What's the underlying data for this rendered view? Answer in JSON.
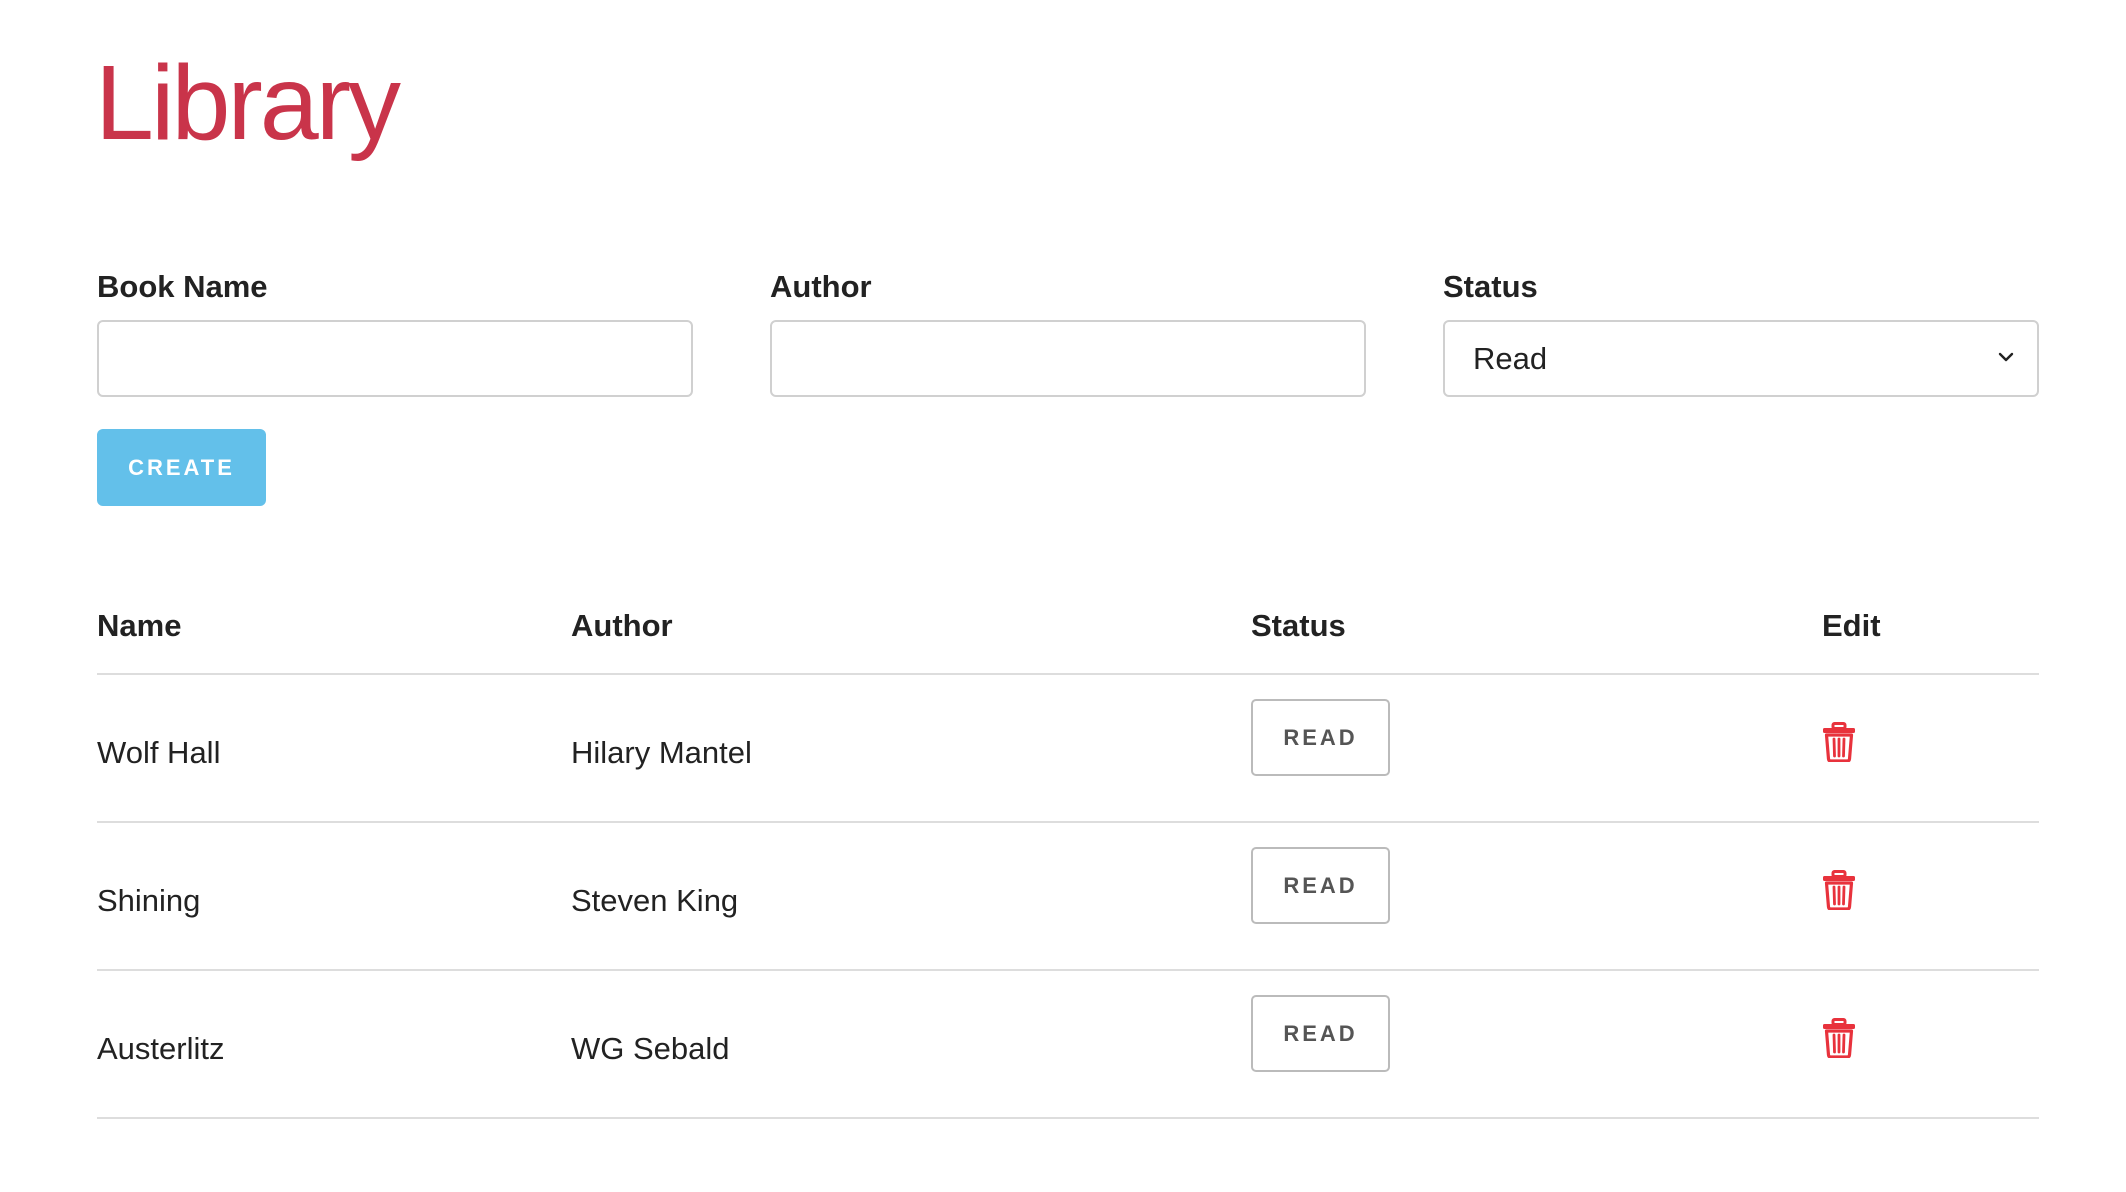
{
  "page": {
    "title": "Library",
    "accent_color": "#c9344a",
    "button_color": "#63c0ea",
    "delete_color": "#e8323c"
  },
  "form": {
    "book_name_label": "Book Name",
    "book_name_value": "",
    "author_label": "Author",
    "author_value": "",
    "status_label": "Status",
    "status_selected": "Read",
    "create_label": "CREATE"
  },
  "table": {
    "headers": {
      "name": "Name",
      "author": "Author",
      "status": "Status",
      "edit": "Edit"
    },
    "rows": [
      {
        "name": "Wolf Hall",
        "author": "Hilary Mantel",
        "status": "READ",
        "edit_icon": "trash-icon"
      },
      {
        "name": "Shining",
        "author": "Steven King",
        "status": "READ",
        "edit_icon": "trash-icon"
      },
      {
        "name": "Austerlitz",
        "author": "WG Sebald",
        "status": "READ",
        "edit_icon": "trash-icon"
      }
    ]
  }
}
